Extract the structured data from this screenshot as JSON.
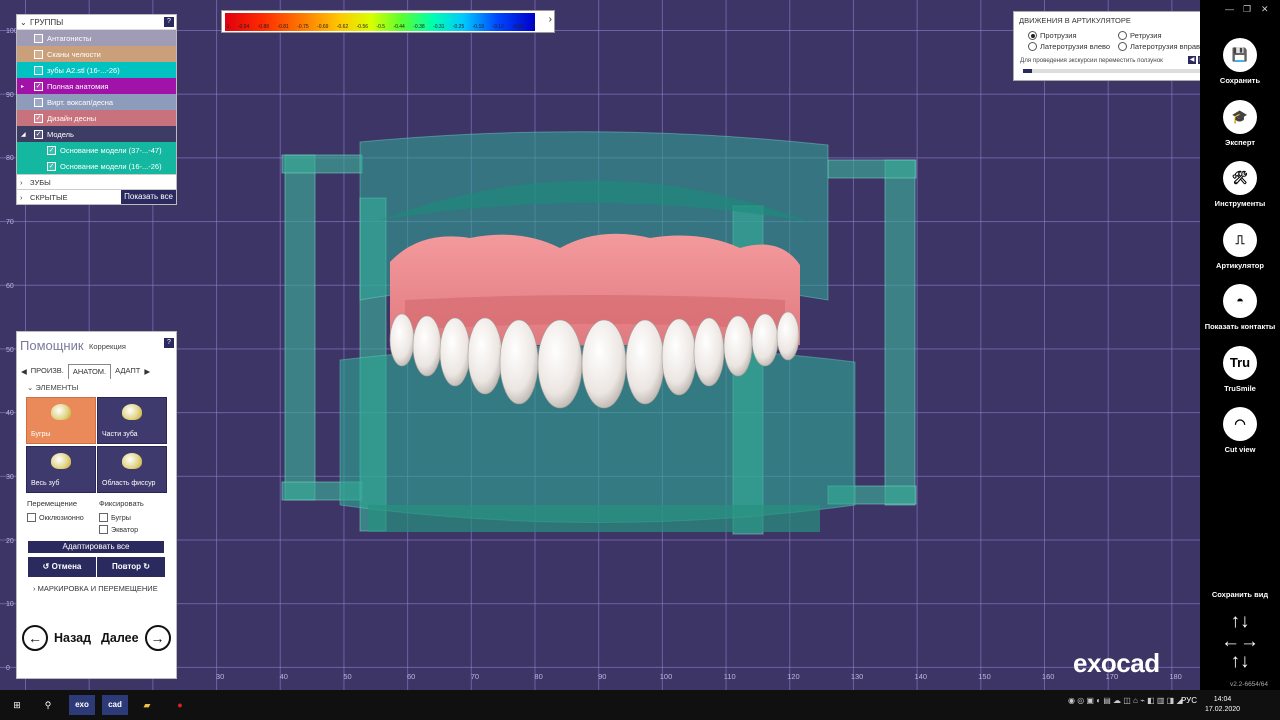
{
  "colors": {
    "accent": "#2b2a5e",
    "viewport_bg": "#3d3566",
    "selected_tile": "#ea8a5a"
  },
  "groups": {
    "header": "ГРУППЫ",
    "help": "?",
    "items": [
      {
        "label": "Антагонисты",
        "checked": false,
        "color": "#a09cb6"
      },
      {
        "label": "Сканы челюсти",
        "checked": false,
        "color": "#c9a07a"
      },
      {
        "label": "зубы A2.stl (16-...-26)",
        "checked": false,
        "color": "#00c2c0"
      },
      {
        "label": "Полная анатомия",
        "checked": true,
        "color": "#a012a8"
      },
      {
        "label": "Вирт. воксап/десна",
        "checked": false,
        "color": "#8d9cba"
      },
      {
        "label": "Дизайн десны",
        "checked": true,
        "color": "#c8727e"
      },
      {
        "label": "Модель",
        "checked": true,
        "color": "#3c3c64"
      },
      {
        "label": "Основание модели (37-...-47)",
        "checked": true,
        "color": "#14b8a0"
      },
      {
        "label": "Основание модели (16-...-26)",
        "checked": true,
        "color": "#14b8a0"
      }
    ],
    "teeth_label": "ЗУБЫ",
    "hidden_label": "СКРЫТЫЕ",
    "show_all": "Показать все"
  },
  "scale": {
    "ticks": [
      "-1",
      "-0.94",
      "-0.88",
      "-0.81",
      "-0.75",
      "-0.69",
      "-0.62",
      "-0.56",
      "-0.5",
      "-0.44",
      "-0.38",
      "-0.31",
      "-0.25",
      "-0.19",
      "-0.12",
      "-0.06",
      "0"
    ],
    "arrow": "›"
  },
  "articulator": {
    "title": "ДВИЖЕНИЯ В АРТИКУЛЯТОРЕ",
    "protrusion": "Протрузия",
    "retrusion": "Ретрузия",
    "lat_left": "Латеротрузия влево",
    "lat_right": "Латеротрузия вправо",
    "hint": "Для проведения экскурсии переместить ползунок",
    "progress": 0.05
  },
  "helper": {
    "title": "Помощник",
    "subtitle": "Коррекция",
    "help": "?",
    "tabs": [
      "ПРОИЗВ.",
      "АНАТОМ.",
      "АДАПТ"
    ],
    "section": "ЭЛЕМЕНТЫ",
    "tiles": [
      "Бугры",
      "Части зуба",
      "Весь зуб",
      "Область фиссур"
    ],
    "move_label": "Перемещение",
    "fix_label": "Фиксировать",
    "occlusal": "Окклюзионно",
    "cusps": "Бугры",
    "equator": "Экватор",
    "adapt_all": "Адаптировать все",
    "undo": "Отмена",
    "redo": "Повтор",
    "marking": "МАРКИРОВКА И ПЕРЕМЕЩЕНИЕ",
    "back": "Назад",
    "next": "Далее"
  },
  "sidebar": {
    "items": [
      {
        "label": "Сохранить",
        "icon": "save-icon"
      },
      {
        "label": "Эксперт",
        "icon": "graduation-cap-icon"
      },
      {
        "label": "Инструменты",
        "icon": "tools-icon"
      },
      {
        "label": "Артикулятор",
        "icon": "articulator-icon"
      },
      {
        "label": "Показать контакты",
        "icon": "contacts-icon"
      },
      {
        "label": "TruSmile",
        "icon": "trusmile-icon"
      },
      {
        "label": "Cut view",
        "icon": "cut-view-icon"
      }
    ],
    "save_view": "Сохранить вид",
    "version": "v2.2-6654/64"
  },
  "logo": "exocad",
  "ruler_x": [
    "0",
    "10",
    "20",
    "30",
    "40",
    "50",
    "60",
    "70",
    "80",
    "90",
    "100",
    "110",
    "120",
    "130",
    "140",
    "150",
    "160",
    "170",
    "180"
  ],
  "ruler_y": [
    "0",
    "10",
    "20",
    "30",
    "40",
    "50",
    "60",
    "70",
    "80",
    "90",
    "100"
  ],
  "taskbar": {
    "apps": [
      "exo",
      "cad"
    ],
    "lang": "РУС",
    "time": "14:04",
    "date": "17.02.2020"
  }
}
